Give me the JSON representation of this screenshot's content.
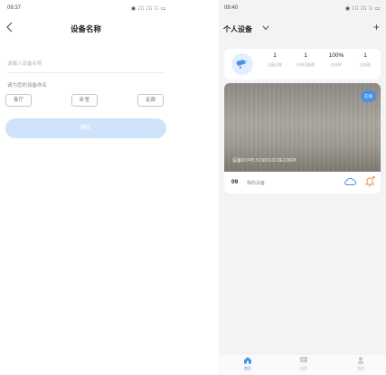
{
  "left_screen": {
    "status": {
      "time": "09:37",
      "icons": "◉ ⁝⁞⁝ ⁝⁞⁝ ⁞⁝ ▭"
    },
    "title": "设备名称",
    "name_placeholder": "请输入设备名称",
    "section_label": "请为您的设备命名",
    "chips": [
      "客厅",
      "卧室",
      "走廊"
    ],
    "confirm_label": "确定"
  },
  "right_screen": {
    "status": {
      "time": "09:40",
      "icons": "◉ ⁝⁞⁝ ⁝⁞⁝ ⁞⁝ ▭"
    },
    "title": "个人设备",
    "plus": "+",
    "stats": [
      {
        "value": "1",
        "label": "设备总数"
      },
      {
        "value": "1",
        "label": "在线设备数"
      },
      {
        "value": "100%",
        "label": "在线率"
      },
      {
        "value": "1",
        "label": "全部图"
      }
    ],
    "device": {
      "online_badge": "在线",
      "device_id": "设备ID:PPLYC90013C9E109F8",
      "number": "09",
      "name": "我的设备"
    },
    "tabs": [
      {
        "label": "首页",
        "icon": "home-icon",
        "active": true
      },
      {
        "label": "消息",
        "icon": "message-icon",
        "active": false
      },
      {
        "label": "我的",
        "icon": "user-icon",
        "active": false
      }
    ],
    "accent_color": "#4a90e2",
    "bell_color": "#f08c3a"
  }
}
